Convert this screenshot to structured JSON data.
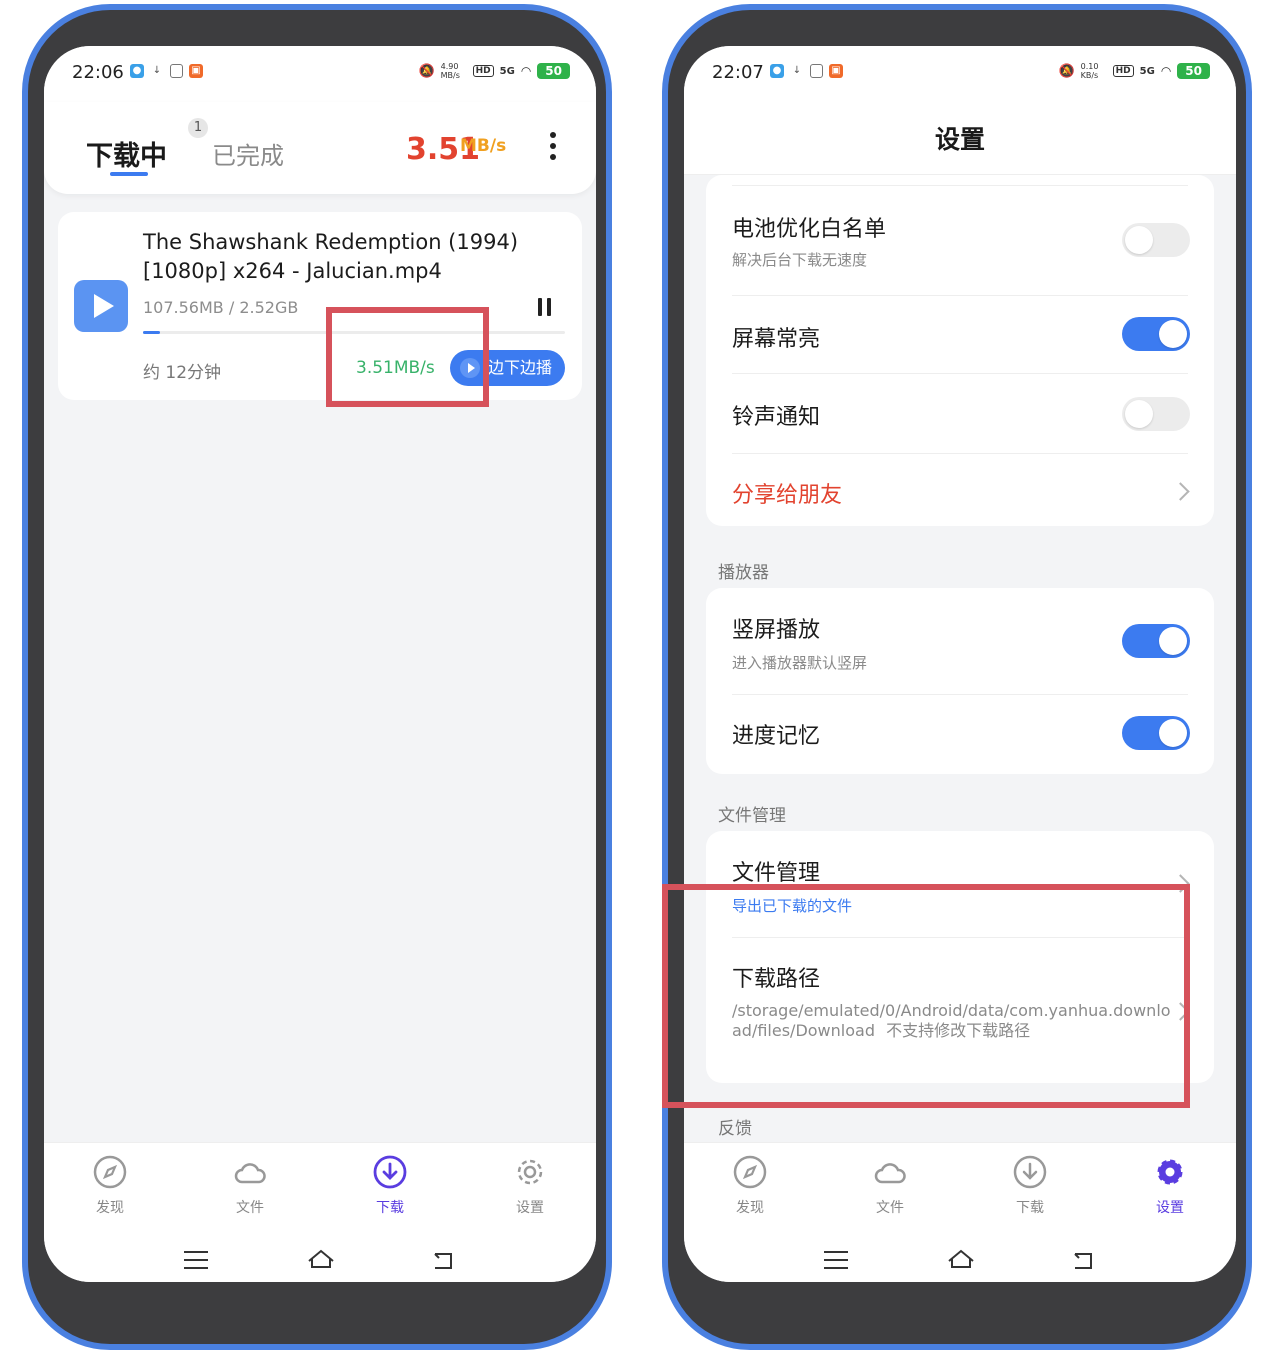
{
  "left_phone": {
    "status": {
      "time": "22:06",
      "net_speed": "4.90 MB/s",
      "network": "5G",
      "battery": "50"
    },
    "header": {
      "tab_downloading": "下载中",
      "tab_badge": "1",
      "tab_completed": "已完成",
      "total_speed_value": "3.51",
      "total_speed_unit": "MB/s"
    },
    "download": {
      "title": "The Shawshank Redemption (1994) [1080p] x264 - Jalucian.mp4",
      "size": "107.56MB / 2.52GB",
      "progress": 0.04,
      "eta": "约 12分钟",
      "speed": "3.51MB/s",
      "play_button": "边下边播"
    }
  },
  "right_phone": {
    "status": {
      "time": "22:07",
      "net_speed": "0.10 KB/s",
      "network": "5G",
      "battery": "50"
    },
    "title": "设置",
    "settings": {
      "battery_whitelist": {
        "title": "电池优化白名单",
        "subtitle": "解决后台下载无速度",
        "enabled": false
      },
      "screen_on": {
        "title": "屏幕常亮",
        "enabled": true
      },
      "ringtone": {
        "title": "铃声通知",
        "enabled": false
      },
      "share": {
        "title": "分享给朋友"
      }
    },
    "player_section": {
      "label": "播放器",
      "portrait": {
        "title": "竖屏播放",
        "subtitle": "进入播放器默认竖屏",
        "enabled": true
      },
      "progress_memory": {
        "title": "进度记忆",
        "enabled": true
      }
    },
    "file_section": {
      "label": "文件管理",
      "file_manage": {
        "title": "文件管理",
        "subtitle": "导出已下载的文件"
      },
      "download_path": {
        "title": "下载路径",
        "path": "/storage/emulated/0/Android/data/com.yanhua.download/files/Download",
        "note": "不支持修改下载路径"
      }
    },
    "feedback_label": "反馈"
  },
  "nav": {
    "discover": "发现",
    "files": "文件",
    "downloads": "下载",
    "settings": "设置"
  },
  "colors": {
    "accent": "#3c7bf0",
    "nav_active": "#5a3de0",
    "speed_red": "#e2432f",
    "speed_green": "#38b26a",
    "highlight_box": "#d6525b",
    "frame": "#4a80e0"
  }
}
